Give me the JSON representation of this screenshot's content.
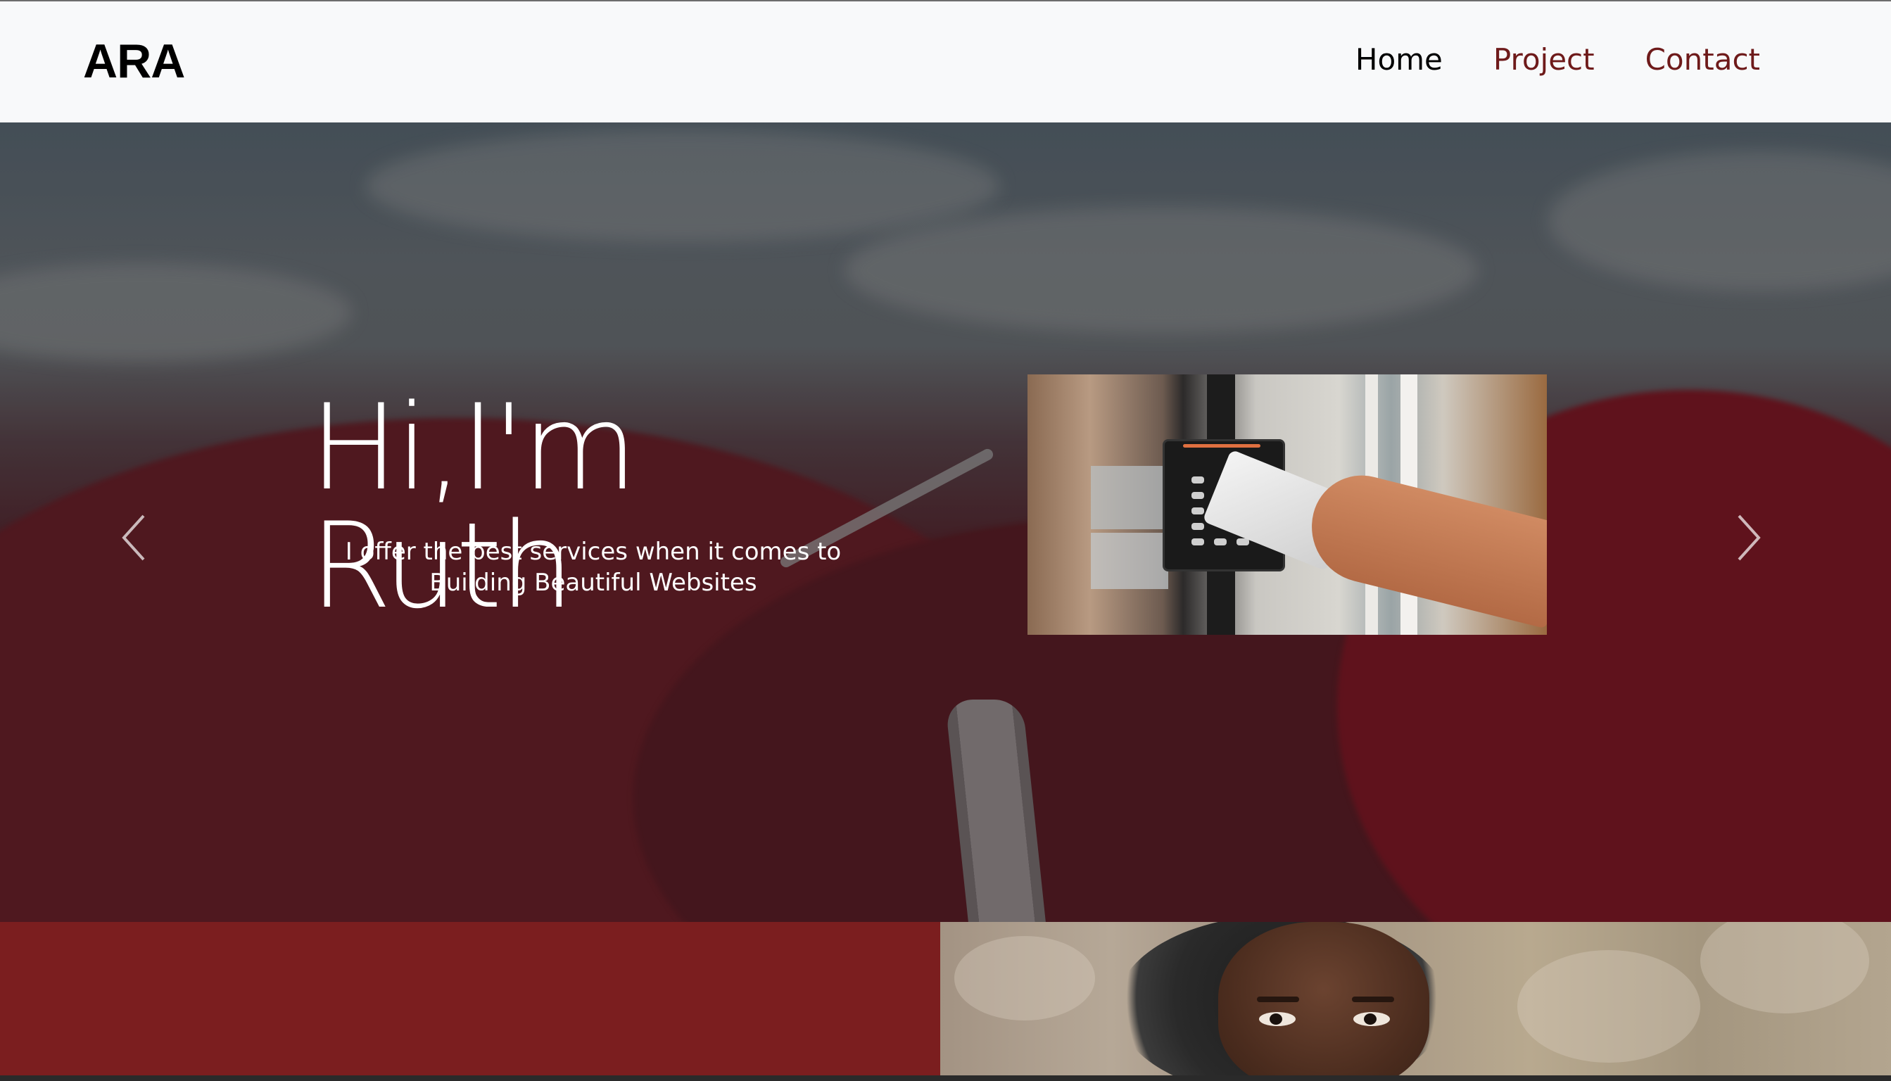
{
  "brand": {
    "name": "ARA"
  },
  "nav": {
    "items": [
      {
        "label": "Home"
      },
      {
        "label": "Project"
      },
      {
        "label": "Contact"
      }
    ]
  },
  "hero": {
    "title": "Hi,I'm Ruth",
    "subtitle_line1": "I offer the best services when it comes to",
    "subtitle_line2": "Building Beautiful Websites"
  },
  "carousel": {
    "prev_icon": "chevron-left-icon",
    "next_icon": "chevron-right-icon"
  },
  "colors": {
    "navbar_bg": "#f8f9fa",
    "brand_text": "#000000",
    "nav_accent": "#6e1a1a",
    "about_panel": "#7b1e1f",
    "hero_text": "#ffffff"
  }
}
